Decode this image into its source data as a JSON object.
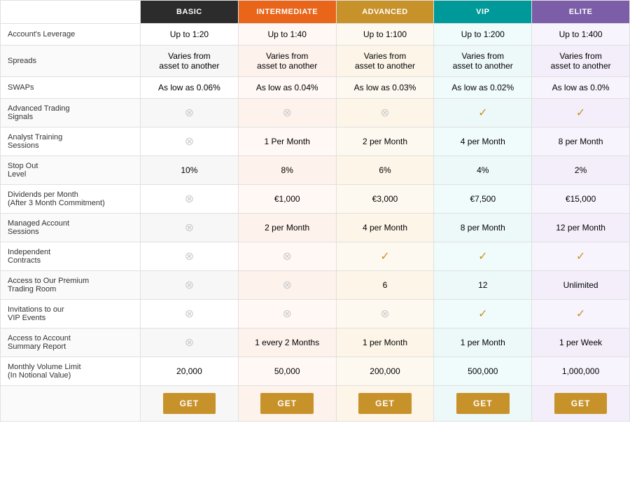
{
  "headers": {
    "feature_col": "",
    "basic": "BASIC",
    "intermediate": "INTERMEDIATE",
    "advanced": "ADVANCED",
    "vip": "VIP",
    "elite": "ELITE"
  },
  "rows": [
    {
      "feature": "Account's Leverage",
      "basic": "Up to 1:20",
      "intermediate": "Up to 1:40",
      "advanced": "Up to 1:100",
      "vip": "Up to 1:200",
      "elite": "Up to 1:400"
    },
    {
      "feature": "Spreads",
      "basic": "Varies from\nasset to another",
      "intermediate": "Varies from\nasset to another",
      "advanced": "Varies from\nasset to another",
      "vip": "Varies from\nasset to another",
      "elite": "Varies from\nasset to another"
    },
    {
      "feature": "SWAPs",
      "basic": "As low as 0.06%",
      "intermediate": "As low as 0.04%",
      "advanced": "As low as 0.03%",
      "vip": "As low as 0.02%",
      "elite": "As low as 0.0%"
    },
    {
      "feature": "Advanced Trading\nSignals",
      "basic": "x",
      "intermediate": "x",
      "advanced": "x",
      "vip": "check",
      "elite": "check"
    },
    {
      "feature": "Analyst Training\nSessions",
      "basic": "x",
      "intermediate": "1 Per Month",
      "advanced": "2 per Month",
      "vip": "4 per Month",
      "elite": "8 per Month"
    },
    {
      "feature": "Stop Out\nLevel",
      "basic": "10%",
      "intermediate": "8%",
      "advanced": "6%",
      "vip": "4%",
      "elite": "2%"
    },
    {
      "feature": "Dividends per Month\n(After 3 Month Commitment)",
      "basic": "x",
      "intermediate": "€1,000",
      "advanced": "€3,000",
      "vip": "€7,500",
      "elite": "€15,000"
    },
    {
      "feature": "Managed Account\nSessions",
      "basic": "x",
      "intermediate": "2 per Month",
      "advanced": "4 per Month",
      "vip": "8 per Month",
      "elite": "12 per Month"
    },
    {
      "feature": "Independent\nContracts",
      "basic": "x",
      "intermediate": "x",
      "advanced": "check",
      "vip": "check",
      "elite": "check"
    },
    {
      "feature": "Access to Our Premium\nTrading Room",
      "basic": "x",
      "intermediate": "x",
      "advanced": "6",
      "vip": "12",
      "elite": "Unlimited"
    },
    {
      "feature": "Invitations to our\nVIP Events",
      "basic": "x",
      "intermediate": "x",
      "advanced": "x",
      "vip": "check",
      "elite": "check"
    },
    {
      "feature": "Access to Account\nSummary Report",
      "basic": "x",
      "intermediate": "1 every 2 Months",
      "advanced": "1 per Month",
      "vip": "1 per Month",
      "elite": "1 per Week"
    },
    {
      "feature": "Monthly Volume Limit\n(In Notional Value)",
      "basic": "20,000",
      "intermediate": "50,000",
      "advanced": "200,000",
      "vip": "500,000",
      "elite": "1,000,000"
    }
  ],
  "buttons": {
    "label": "GET"
  }
}
